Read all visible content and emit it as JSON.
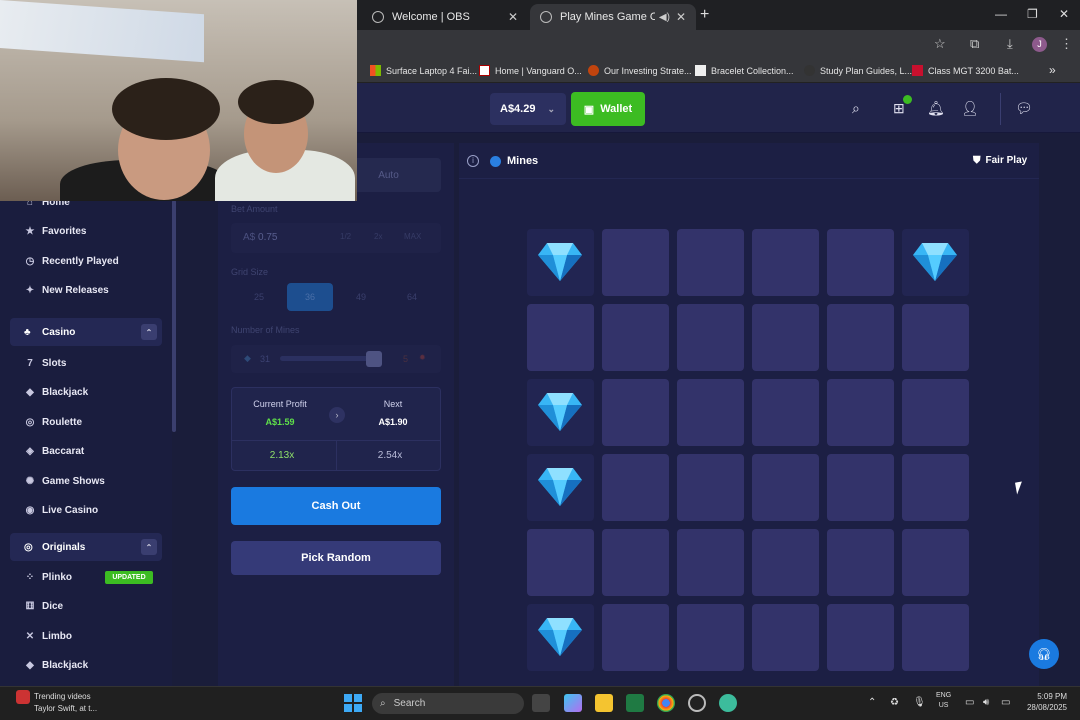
{
  "browser": {
    "tabs": [
      {
        "title": "Welcome | OBS"
      },
      {
        "title": "Play Mines Game Online at"
      }
    ],
    "bookmarks": [
      {
        "label": "Surface Laptop 4 Fai..."
      },
      {
        "label": "Home | Vanguard O..."
      },
      {
        "label": "Our Investing Strate..."
      },
      {
        "label": "Bracelet Collection..."
      },
      {
        "label": "Study Plan Guides, L..."
      },
      {
        "label": "Class MGT 3200 Bat..."
      }
    ],
    "profile_initial": "J"
  },
  "header": {
    "balance": "A$4.29",
    "wallet_label": "Wallet"
  },
  "sidebar": {
    "items_top": [
      {
        "label": "Home",
        "icon": "home-icon"
      },
      {
        "label": "Favorites",
        "icon": "star-icon"
      },
      {
        "label": "Recently Played",
        "icon": "history-icon"
      },
      {
        "label": "New Releases",
        "icon": "new-icon"
      }
    ],
    "casino_group": "Casino",
    "casino_items": [
      {
        "label": "Slots"
      },
      {
        "label": "Blackjack"
      },
      {
        "label": "Roulette"
      },
      {
        "label": "Baccarat"
      },
      {
        "label": "Game Shows"
      },
      {
        "label": "Live Casino"
      }
    ],
    "originals_group": "Originals",
    "originals_items": [
      {
        "label": "Plinko",
        "badge": "UPDATED"
      },
      {
        "label": "Dice"
      },
      {
        "label": "Limbo"
      },
      {
        "label": "Blackjack"
      }
    ]
  },
  "controls": {
    "auto_tab": "Auto",
    "bet_amount_label": "Bet Amount",
    "bet_currency": "A$",
    "bet_value": "0.75",
    "bet_mini": [
      "1/2",
      "2x",
      "MAX"
    ],
    "grid_size_label": "Grid Size",
    "grid_options": [
      "25",
      "36",
      "49",
      "64"
    ],
    "grid_selected": "36",
    "mines_label": "Number of Mines",
    "mines_gems": "31",
    "mines_count": "5",
    "current_profit_label": "Current Profit",
    "current_profit_value": "A$1.59",
    "next_label": "Next",
    "next_value": "A$1.90",
    "current_multiplier": "2.13x",
    "next_multiplier": "2.54x",
    "cashout_label": "Cash Out",
    "pick_random_label": "Pick Random"
  },
  "game": {
    "title": "Mines",
    "fair_play": "Fair Play",
    "grid_size": 6,
    "revealed_gems": [
      [
        0,
        0
      ],
      [
        0,
        5
      ],
      [
        2,
        0
      ],
      [
        3,
        0
      ],
      [
        5,
        0
      ]
    ]
  },
  "taskbar": {
    "news_title": "Trending videos",
    "news_sub": "Taylor Swift, at t...",
    "search_placeholder": "Search",
    "lang_top": "ENG",
    "lang_bottom": "US",
    "time": "5:09 PM",
    "date": "28/08/2025"
  },
  "colors": {
    "accent_green": "#3cbc22",
    "accent_blue": "#1a7ae0",
    "tile": "#33336a",
    "profit_green": "#5fe04a"
  }
}
